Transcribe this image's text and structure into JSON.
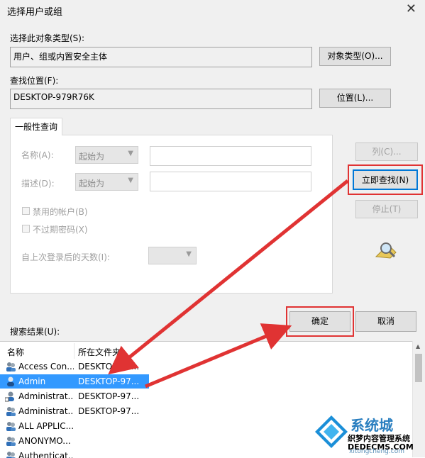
{
  "window": {
    "title": "选择用户或组"
  },
  "object_type": {
    "label": "选择此对象类型(S):",
    "value": "用户、组或内置安全主体",
    "button": "对象类型(O)..."
  },
  "location": {
    "label": "查找位置(F):",
    "value": "DESKTOP-979R76K",
    "button": "位置(L)..."
  },
  "tab": {
    "label": "一般性查询"
  },
  "query": {
    "name_label": "名称(A):",
    "name_mode": "起始为",
    "desc_label": "描述(D):",
    "desc_mode": "起始为",
    "disabled_accounts": "禁用的帐户(B)",
    "non_expiring_pw": "不过期密码(X)",
    "days_label": "自上次登录后的天数(I):"
  },
  "side_buttons": {
    "columns": "列(C)...",
    "find_now": "立即查找(N)",
    "stop": "停止(T)"
  },
  "dialog_buttons": {
    "ok": "确定",
    "cancel": "取消"
  },
  "results": {
    "label": "搜索结果(U):",
    "headers": [
      "名称",
      "所在文件夹"
    ],
    "rows": [
      {
        "name": "Access Con...",
        "folder": "DESKTOP-97...",
        "selected": false,
        "icon": "group-icon"
      },
      {
        "name": "Admin",
        "folder": "DESKTOP-97...",
        "selected": true,
        "icon": "user-icon"
      },
      {
        "name": "Administrat...",
        "folder": "DESKTOP-97...",
        "selected": false,
        "icon": "user-icon"
      },
      {
        "name": "Administrat...",
        "folder": "DESKTOP-97...",
        "selected": false,
        "icon": "group-icon"
      },
      {
        "name": "ALL APPLIC...",
        "folder": "",
        "selected": false,
        "icon": "group-icon"
      },
      {
        "name": "ANONYMO...",
        "folder": "",
        "selected": false,
        "icon": "group-icon"
      },
      {
        "name": "Authenticat...",
        "folder": "",
        "selected": false,
        "icon": "group-icon"
      }
    ]
  },
  "watermark": {
    "brand": "系统城",
    "line1": "织梦内容管理系统",
    "line2": "DEDECMS.COM",
    "line3": "xitongcheng.com"
  },
  "colors": {
    "highlight": "#e03333",
    "selection": "#3399ff"
  }
}
